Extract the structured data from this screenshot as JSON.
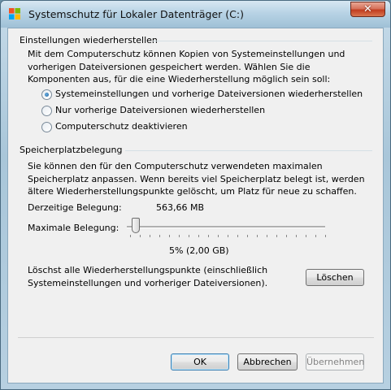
{
  "window": {
    "title": "Systemschutz für Lokaler Datenträger (C:)",
    "close_glyph": "✕"
  },
  "restore": {
    "heading": "Einstellungen wiederherstellen",
    "description": "Mit dem Computerschutz können Kopien von Systemeinstellungen und vorherigen Dateiversionen gespeichert werden. Wählen Sie die Komponenten aus, für die eine Wiederherstellung möglich sein soll:",
    "options": [
      {
        "label": "Systemeinstellungen und vorherige Dateiversionen wiederherstellen",
        "checked": true
      },
      {
        "label": "Nur vorherige Dateiversionen wiederherstellen",
        "checked": false
      },
      {
        "label": "Computerschutz deaktivieren",
        "checked": false
      }
    ]
  },
  "usage": {
    "heading": "Speicherplatzbelegung",
    "description": "Sie können den für den Computerschutz verwendeten maximalen Speicherplatz anpassen. Wenn bereits viel Speicherplatz belegt ist, werden ältere Wiederherstellungspunkte gelöscht, um Platz für neue zu schaffen.",
    "current_label": "Derzeitige Belegung:",
    "current_value": "563,66 MB",
    "max_label": "Maximale Belegung:",
    "max_value": "5% (2,00 GB)",
    "slider_fraction": 0.05,
    "delete_text": "Löschst alle Wiederherstellungspunkte (einschließlich Systemeinstellungen und vorheriger Dateiversionen).",
    "delete_button": "Löschen"
  },
  "footer": {
    "ok": "OK",
    "cancel": "Abbrechen",
    "apply": "Übernehmen"
  }
}
